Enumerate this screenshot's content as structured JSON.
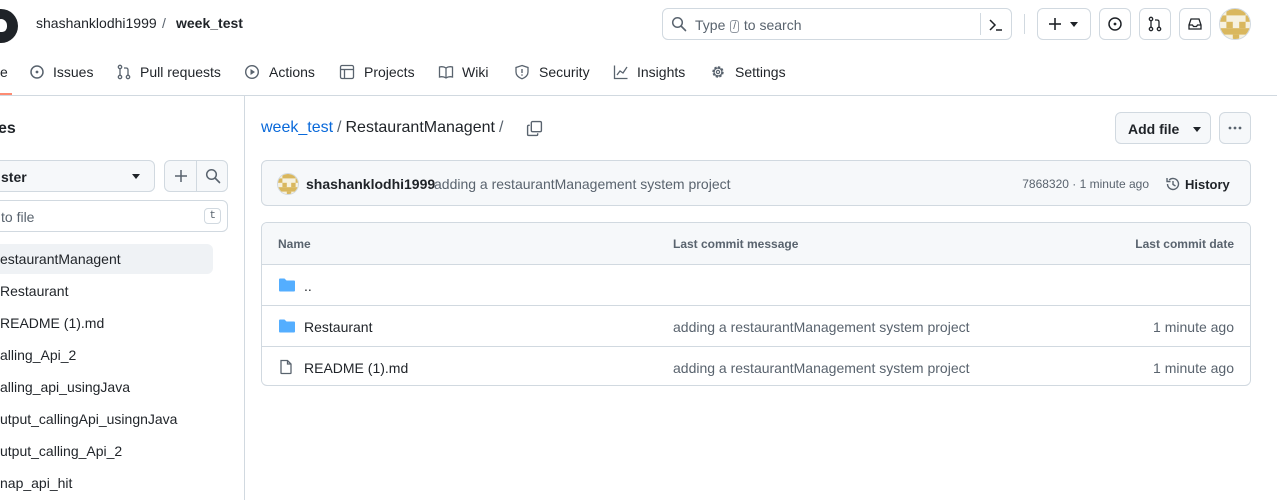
{
  "header": {
    "owner": "shashanklodhi1999",
    "separator": "/",
    "repo": "week_test",
    "search": {
      "before": "Type",
      "key": "/",
      "after": "to search"
    }
  },
  "tabs": [
    {
      "label": "e",
      "icon": "code-icon"
    },
    {
      "label": "Issues",
      "icon": "issue-icon"
    },
    {
      "label": "Pull requests",
      "icon": "pull-request-icon"
    },
    {
      "label": "Actions",
      "icon": "play-icon"
    },
    {
      "label": "Projects",
      "icon": "table-icon"
    },
    {
      "label": "Wiki",
      "icon": "book-icon"
    },
    {
      "label": "Security",
      "icon": "shield-icon"
    },
    {
      "label": "Insights",
      "icon": "graph-icon"
    },
    {
      "label": "Settings",
      "icon": "gear-icon"
    }
  ],
  "sidebar": {
    "title": "es",
    "branch": "ster",
    "goto_placeholder": "to file",
    "goto_key": "t",
    "items": [
      {
        "label": "estaurantManagent",
        "active": true
      },
      {
        "label": "Restaurant"
      },
      {
        "label": "README (1).md"
      },
      {
        "label": "alling_Api_2"
      },
      {
        "label": "alling_api_usingJava"
      },
      {
        "label": "utput_callingApi_usingnJava"
      },
      {
        "label": "utput_calling_Api_2"
      },
      {
        "label": "nap_api_hit"
      }
    ]
  },
  "breadcrumb": {
    "repo_link": "week_test",
    "sep1": "/",
    "current": "RestaurantManagent",
    "sep2": "/"
  },
  "actions": {
    "add_file": "Add file"
  },
  "commit": {
    "author": "shashanklodhi1999",
    "message": "adding a restaurantManagement system project",
    "meta": "7868320 · 1 minute ago",
    "history": "History"
  },
  "table": {
    "headers": {
      "name": "Name",
      "message": "Last commit message",
      "date": "Last commit date"
    },
    "rows": [
      {
        "name": "..",
        "type": "folder",
        "message": "",
        "date": ""
      },
      {
        "name": "Restaurant",
        "type": "folder",
        "message": "adding a restaurantManagement system project",
        "date": "1 minute ago"
      },
      {
        "name": "README (1).md",
        "type": "file",
        "message": "adding a restaurantManagement system project",
        "date": "1 minute ago"
      }
    ]
  },
  "colors": {
    "link": "#0969da",
    "folder": "#54aeff",
    "underline": "#fd8c73"
  }
}
